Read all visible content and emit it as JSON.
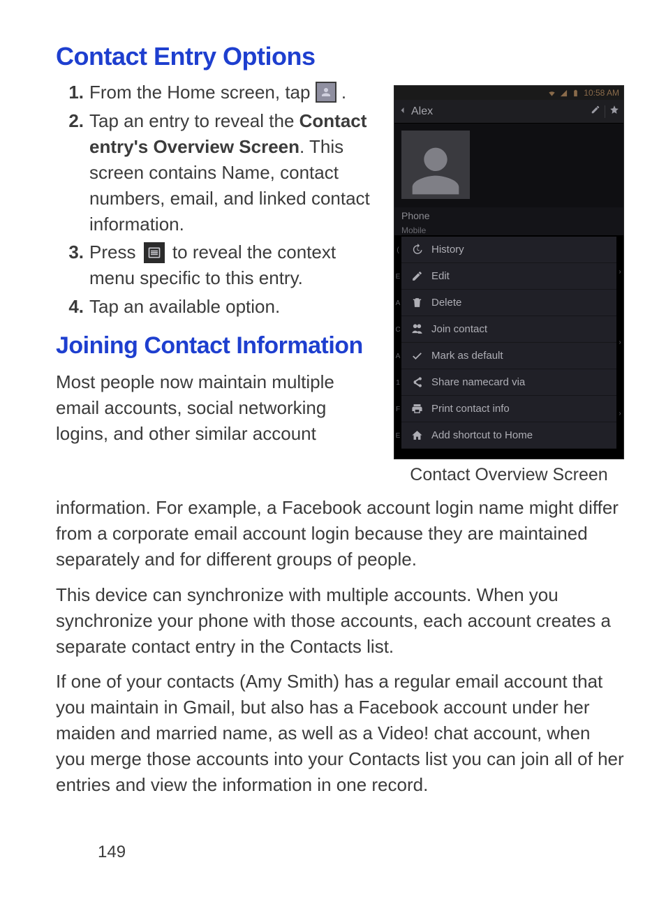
{
  "heading_options": "Contact Entry Options",
  "steps": {
    "s1": {
      "num": "1.",
      "pre": "From the Home screen, tap ",
      "post": " ."
    },
    "s2": {
      "num": "2.",
      "pre": "Tap an entry to reveal the ",
      "bold": "Contact entry's Overview Screen",
      "post": ". This screen contains Name, contact numbers, email, and linked contact information."
    },
    "s3": {
      "num": "3.",
      "pre": "Press ",
      "post": " to reveal the context menu specific to this entry."
    },
    "s4": {
      "num": "4.",
      "text": "Tap an available option."
    }
  },
  "heading_joining": "Joining Contact Information",
  "left_body": "Most people now maintain multiple email accounts, social networking logins, and other similar account",
  "full_p1": "information. For example, a Facebook account login name might differ from a corporate email account login because they are maintained separately and for different groups of people.",
  "full_p2": "This device can synchronize with multiple accounts. When you synchronize your phone with those accounts, each account creates a separate contact entry in the Contacts list.",
  "full_p3": "If one of your contacts (Amy Smith) has a regular email account that you maintain in Gmail, but also has a Facebook account under her maiden and married name, as well as a Video! chat account, when you merge those accounts into your Contacts list you can join all of her entries and view the information in one record.",
  "page_num": "149",
  "phone": {
    "time": "10:58 AM",
    "contact_name": "Alex",
    "section_phone": "Phone",
    "section_mobile": "Mobile",
    "menu": {
      "history": "History",
      "edit": "Edit",
      "delete": "Delete",
      "join": "Join contact",
      "mark": "Mark as default",
      "share": "Share namecard via",
      "print": "Print contact info",
      "shortcut": "Add shortcut to Home"
    }
  },
  "caption": "Contact Overview Screen"
}
